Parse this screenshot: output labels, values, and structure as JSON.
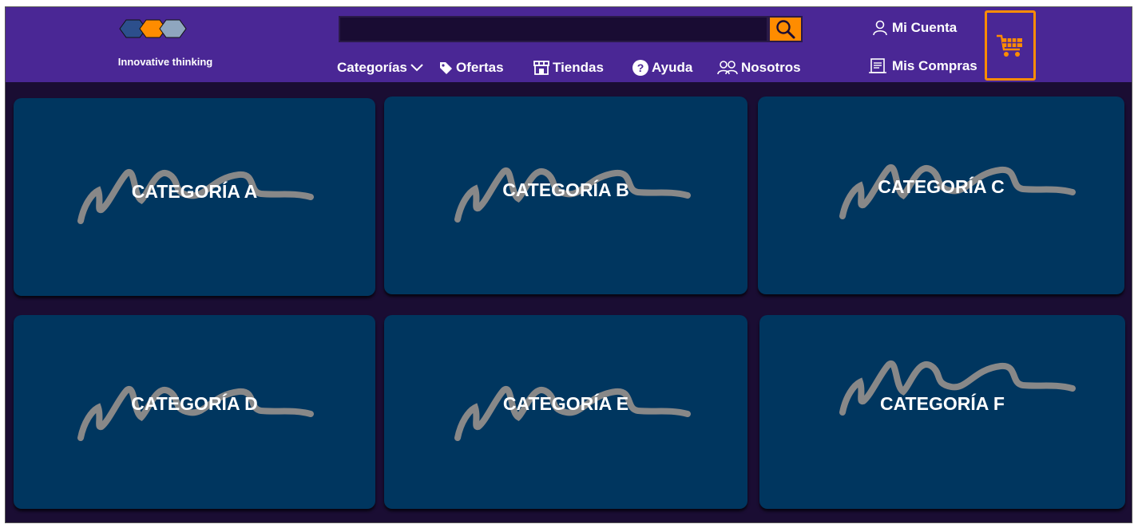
{
  "brand": {
    "tagline": "Innovative thinking",
    "logo_colors": [
      "#2c4f8c",
      "#ff8c00",
      "#8fa6bf"
    ]
  },
  "search": {
    "value": "",
    "placeholder": "",
    "icon": "search-icon"
  },
  "nav": {
    "items": [
      {
        "label": "Categorías",
        "icon": "chevron-down-icon"
      },
      {
        "label": "Ofertas",
        "icon": "tag-icon"
      },
      {
        "label": "Tiendas",
        "icon": "store-icon"
      },
      {
        "label": "Ayuda",
        "icon": "help-icon"
      },
      {
        "label": "Nosotros",
        "icon": "users-icon"
      }
    ]
  },
  "account": {
    "my_account": "Mi Cuenta",
    "my_purchases": "Mis Compras"
  },
  "cart": {
    "icon": "cart-icon"
  },
  "categories": [
    {
      "label": "CATEGORÍA A"
    },
    {
      "label": "CATEGORÍA B"
    },
    {
      "label": "CATEGORÍA C"
    },
    {
      "label": "CATEGORÍA D"
    },
    {
      "label": "CATEGORÍA E"
    },
    {
      "label": "CATEGORÍA F"
    }
  ],
  "colors": {
    "header_bg": "#4a2795",
    "page_bg": "#1a0d33",
    "card_bg": "#00365f",
    "accent": "#ff8c00"
  }
}
